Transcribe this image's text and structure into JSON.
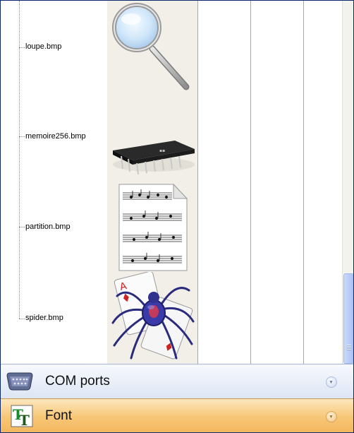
{
  "files": [
    {
      "name": "loupe.bmp",
      "icon": "magnifier-icon"
    },
    {
      "name": "memoire256.bmp",
      "icon": "memory-chip-icon"
    },
    {
      "name": "partition.bmp",
      "icon": "sheet-music-icon"
    },
    {
      "name": "spider.bmp",
      "icon": "spider-solitaire-icon"
    }
  ],
  "panels": {
    "com": {
      "title": "COM ports",
      "icon": "serial-port-icon"
    },
    "font": {
      "title": "Font",
      "icon": "font-icon"
    }
  },
  "colors": {
    "selected_panel": "#f7c675",
    "panel": "#dde5f4",
    "scroll_thumb": "#b6ccf6"
  }
}
